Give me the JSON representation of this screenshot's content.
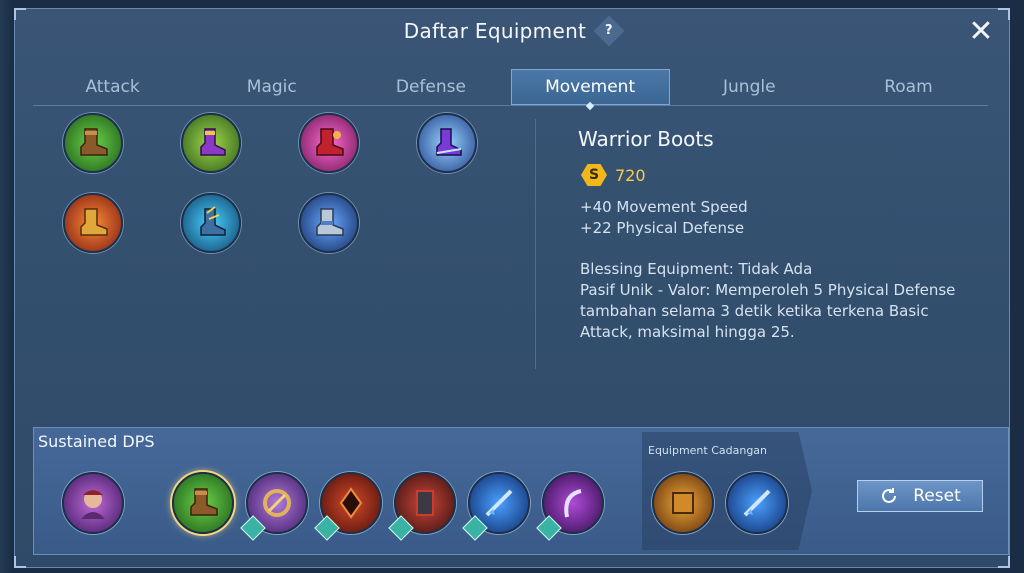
{
  "header": {
    "title": "Daftar Equipment",
    "help_label": "?",
    "close_label": "✕"
  },
  "tabs": [
    {
      "label": "Attack",
      "active": false
    },
    {
      "label": "Magic",
      "active": false
    },
    {
      "label": "Defense",
      "active": false
    },
    {
      "label": "Movement",
      "active": true
    },
    {
      "label": "Jungle",
      "active": false
    },
    {
      "label": "Roam",
      "active": false
    }
  ],
  "items": [
    {
      "icon": "warrior-boots-icon",
      "color": "#3e8f2c"
    },
    {
      "icon": "magic-shoes-icon",
      "color": "#4e7d2a"
    },
    {
      "icon": "arcane-boots-icon",
      "color": "#b0338f"
    },
    {
      "icon": "swift-boots-icon",
      "color": "#2e6bc6"
    },
    {
      "icon": "rapid-boots-icon",
      "color": "#b83a1c"
    },
    {
      "icon": "demon-shoes-icon",
      "color": "#2b6fa8"
    },
    {
      "icon": "tough-boots-icon",
      "color": "#264f9a"
    }
  ],
  "detail": {
    "name": "Warrior Boots",
    "currency_symbol": "S",
    "price": "720",
    "stat_1": "+40 Movement Speed",
    "stat_2": "+22 Physical Defense",
    "blessing": "Blessing Equipment: Tidak Ada",
    "passive": "Pasif Unik - Valor: Memperoleh 5 Physical Defense tambahan selama 3 detik ketika terkena Basic Attack, maksimal hingga 25."
  },
  "build": {
    "label": "Sustained DPS",
    "reserve_label": "Equipment Cadangan",
    "reset_label": "Reset"
  },
  "colors": {
    "accent": "#4b78a8",
    "gold": "#f1b81c",
    "swap": "#3bb3a4"
  }
}
